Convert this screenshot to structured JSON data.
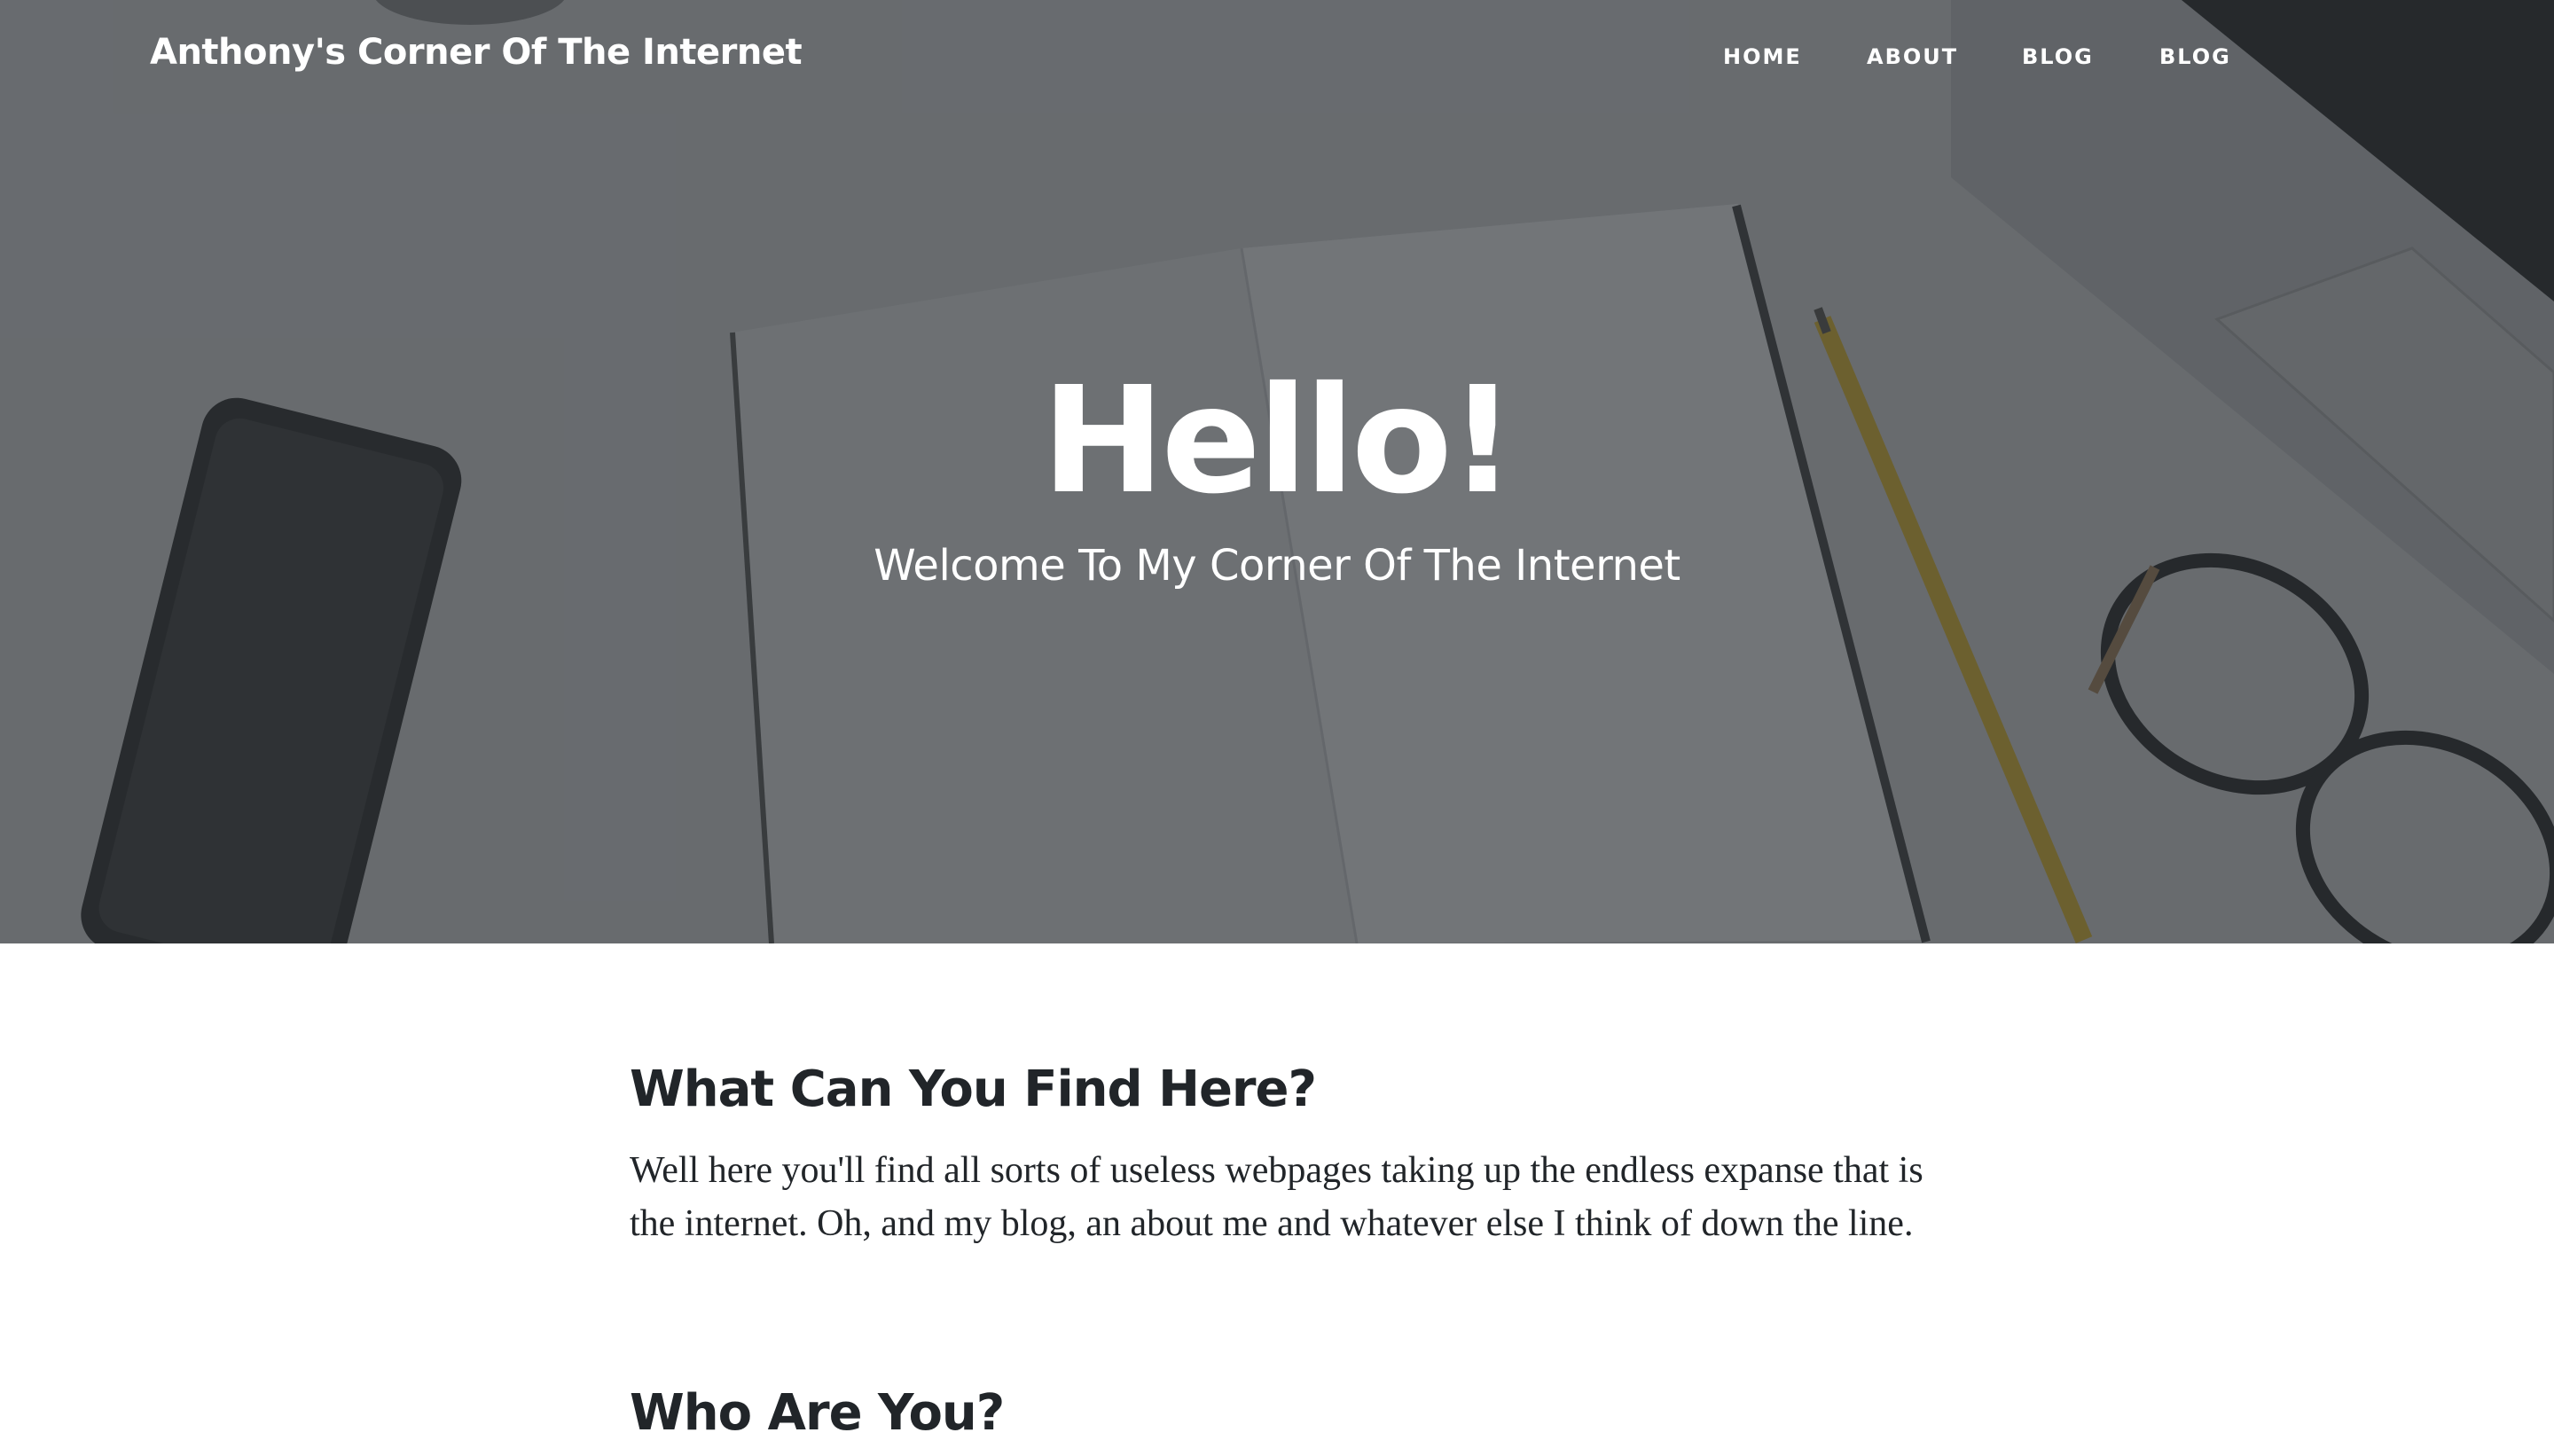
{
  "navbar": {
    "brand": "Anthony's Corner Of The Internet",
    "links": [
      "HOME",
      "ABOUT",
      "BLOG",
      "BLOG"
    ]
  },
  "hero": {
    "title": "Hello!",
    "subtitle": "Welcome To My Corner Of The Internet"
  },
  "content": {
    "sections": [
      {
        "heading": "What Can You Find Here?",
        "body": "Well here you'll find all sorts of useless webpages taking up the endless expanse that is the internet. Oh, and my blog, an about me and whatever else I think of down the line."
      },
      {
        "heading": "Who Are You?"
      }
    ]
  },
  "colors": {
    "overlay": "#212529",
    "text_dark": "#212529",
    "nav_text": "#ffffff"
  }
}
